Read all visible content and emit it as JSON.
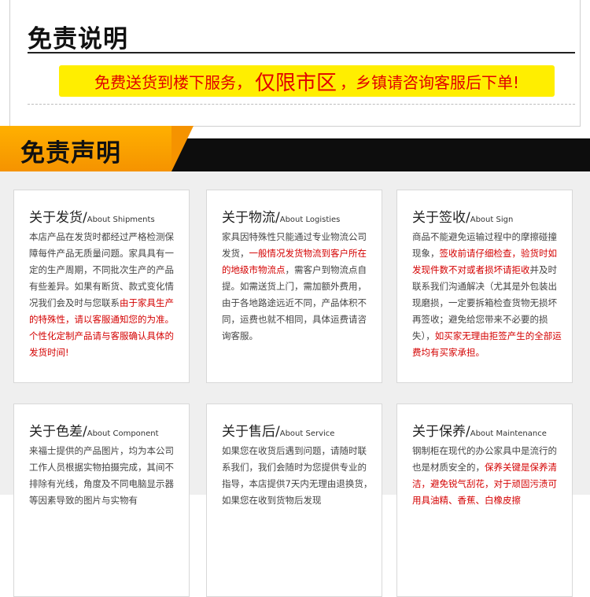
{
  "top": {
    "title": "免责说明",
    "notice_part1": "免费送货到楼下服务，",
    "notice_part2": "仅限市区",
    "notice_part3": "，乡镇请咨询客服后下单!"
  },
  "banner": {
    "title": "免责声明"
  },
  "cards": [
    {
      "zh": "关于发货",
      "en": "About Shipments",
      "p1": "本店产品在发货时都经过严格检测保障每件产品无质量问题。家具具有一定的生产周期，不同批次生产的产品有些差异。如果有断货、款式变化情况我们会及时与您联系",
      "p2": "由于家具生产的特殊性，请以客服通知您的为准。个性化定制产品请与客服确认具体的发货时间!",
      "p3": ""
    },
    {
      "zh": "关于物流",
      "en": "About Logisties",
      "p1": "家具因特殊性只能通过专业物流公司发货，",
      "p2": "一般情况发货物流到客户所在的地级市物流点",
      "p3": "，需客户到物流点自提。如需送货上门，需加额外费用，由于各地路途远近不同，产品体积不同，运费也就不相同，具体运费请咨询客服。"
    },
    {
      "zh": "关于签收",
      "en": "About Sign",
      "p1": "商品不能避免运输过程中的摩擦碰撞现象，",
      "p2": "签收前请仔细检查，验货时如发现件数不对或者损坏请拒收",
      "p3": "并及时联系我们沟通解决（尤其是外包装出现磨损，一定要拆箱检查货物无损坏再签收；避免给您带来不必要的损失），",
      "p4": "如买家无理由拒签产生的全部运费均有买家承担。"
    },
    {
      "zh": "关于色差",
      "en": "About Component",
      "p1": "来福士提供的产品图片，均为本公司工作人员根据实物拍摄完成，其间不排除有光线，角度及不同电脑显示器等因素导致的图片与实物有",
      "p2": "",
      "p3": ""
    },
    {
      "zh": "关于售后",
      "en": "About Service",
      "p1": "如果您在收货后遇到问题，请随时联系我们，我们会随时为您提供专业的指导，本店提供7天内无理由退换货，如果您在收到货物后发现",
      "p2": "",
      "p3": ""
    },
    {
      "zh": "关于保养",
      "en": "About Maintenance",
      "p1": "钢制柜在现代的办公家具中是流行的也是材质安全的，",
      "p2": "保养关键是保养清洁，避免锐气刮花，对于顽固污渍可用具油精、香蕉、白橡皮擦",
      "p3": ""
    }
  ]
}
